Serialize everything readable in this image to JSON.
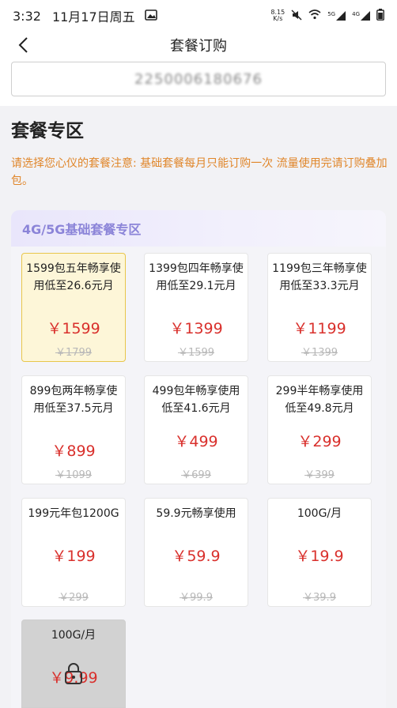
{
  "status_bar": {
    "time": "3:32",
    "date": "11月17日周五",
    "net_speed_value": "8.15",
    "net_speed_unit": "K/s",
    "signal1": "5G",
    "signal2": "4G"
  },
  "nav": {
    "title": "套餐订购"
  },
  "phone": {
    "number": "22500061806​76"
  },
  "section": {
    "title": "套餐专区",
    "notice": "请选择您心仪的套餐注意: 基础套餐每月只能订购一次 流量使用完请订购叠加包。"
  },
  "zone": {
    "title": "4G/5G基础套餐专区",
    "packages": [
      {
        "name": "1599包五年畅享使用低至26.6元月",
        "price": "￥1599",
        "original": "￥1799",
        "selected": true
      },
      {
        "name": "1399包四年畅享使用低至29.1元月",
        "price": "￥1399",
        "original": "￥1599"
      },
      {
        "name": "1199包三年畅享使用低至33.3元月",
        "price": "￥1199",
        "original": "￥1399"
      },
      {
        "name": "899包两年畅享使用低至37.5元月",
        "price": "￥899",
        "original": "￥1099"
      },
      {
        "name": "499包年畅享使用低至41.6元月",
        "price": "￥499",
        "original": "￥699"
      },
      {
        "name": "299半年畅享使用低至49.8元月",
        "price": "￥299",
        "original": "￥399"
      },
      {
        "name": "199元年包1200G",
        "price": "￥199",
        "original": "￥299"
      },
      {
        "name": "59.9元畅享使用",
        "price": "￥59.9",
        "original": "￥99.9"
      },
      {
        "name": "100G/月",
        "price": "￥19.9",
        "original": "￥39.9"
      },
      {
        "name": "100G/月",
        "price": "￥9.99",
        "original": "",
        "locked": true
      }
    ]
  },
  "colors": {
    "accent_price": "#d9302c",
    "notice_orange": "#e0862a",
    "zone_title_purple": "#8b84d8",
    "selected_bg": "#fdf6d8",
    "selected_border": "#e8c64b"
  }
}
